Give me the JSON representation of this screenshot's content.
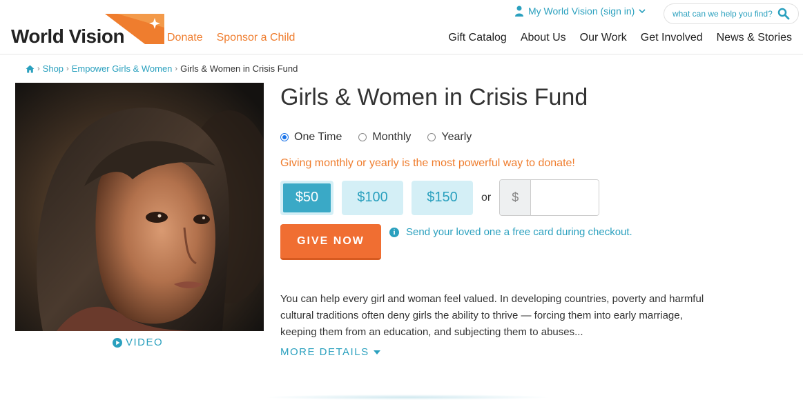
{
  "header": {
    "logo_text": "World Vision",
    "primary_links": [
      "Donate",
      "Sponsor a Child"
    ],
    "account_label": "My World Vision (sign in)",
    "search_placeholder": "what can we help you find?",
    "nav": [
      "Gift Catalog",
      "About Us",
      "Our Work",
      "Get Involved",
      "News & Stories"
    ]
  },
  "breadcrumb": {
    "items": [
      "Shop",
      "Empower Girls & Women"
    ],
    "current": "Girls & Women in Crisis Fund"
  },
  "media": {
    "video_label": "VIDEO"
  },
  "product": {
    "title": "Girls & Women in Crisis Fund",
    "frequency_options": [
      "One Time",
      "Monthly",
      "Yearly"
    ],
    "selected_frequency": "One Time",
    "promo": "Giving monthly or yearly is the most powerful way to donate!",
    "amounts": [
      "$50",
      "$100",
      "$150"
    ],
    "selected_amount": "$50",
    "or_label": "or",
    "currency_symbol": "$",
    "custom_amount_value": "",
    "give_button": "GIVE NOW",
    "card_note": "Send your loved one a free card during checkout.",
    "description": "You can help every girl and woman feel valued. In developing countries, poverty and harmful cultural traditions often deny girls the ability to thrive — forcing them into early marriage, keeping them from an education, and subjecting them to abuses...",
    "more_details": "MORE DETAILS"
  },
  "colors": {
    "brand_orange": "#ef7d2e",
    "button_orange": "#f06e32",
    "link_teal": "#2aa0be",
    "amount_bg": "#d4eff6",
    "amount_selected": "#3aa9c6"
  }
}
